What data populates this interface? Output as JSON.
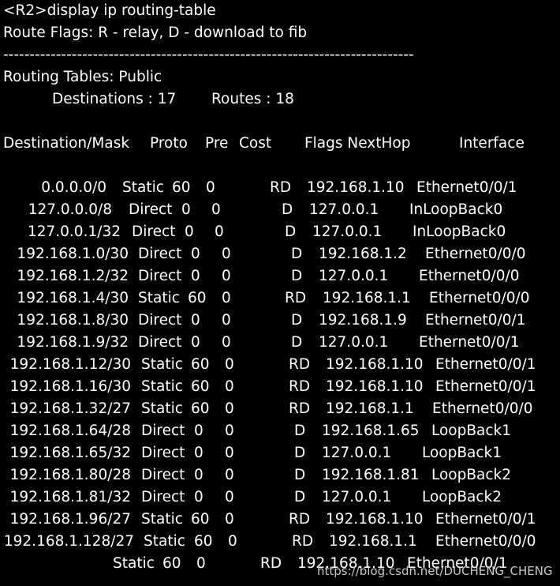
{
  "terminal": {
    "command_line": "<R2>display ip routing-table",
    "route_flags": "Route Flags: R - relay, D - download to fib",
    "separator": "------------------------------------------------------------------------------",
    "table_name": "Routing Tables: Public",
    "destinations_label": "Destinations : 17",
    "routes_label": "Routes : 18",
    "headers": {
      "destination": "Destination/Mask",
      "proto": "Proto",
      "pre": "Pre",
      "cost": "Cost",
      "flags_nexthop": "Flags NextHop",
      "interface": "Interface"
    },
    "rows": [
      {
        "dest": "0.0.0.0/0",
        "proto": "Static",
        "pre": "60",
        "cost": "0",
        "flags": "RD",
        "nexthop": "192.168.1.10",
        "iface": "Ethernet0/0/1"
      },
      {
        "dest": "127.0.0.0/8",
        "proto": "Direct",
        "pre": "0",
        "cost": "0",
        "flags": "D",
        "nexthop": "127.0.0.1",
        "iface": "InLoopBack0"
      },
      {
        "dest": "127.0.0.1/32",
        "proto": "Direct",
        "pre": "0",
        "cost": "0",
        "flags": "D",
        "nexthop": "127.0.0.1",
        "iface": "InLoopBack0"
      },
      {
        "dest": "192.168.1.0/30",
        "proto": "Direct",
        "pre": "0",
        "cost": "0",
        "flags": "D",
        "nexthop": "192.168.1.2",
        "iface": "Ethernet0/0/0"
      },
      {
        "dest": "192.168.1.2/32",
        "proto": "Direct",
        "pre": "0",
        "cost": "0",
        "flags": "D",
        "nexthop": "127.0.0.1",
        "iface": "Ethernet0/0/0"
      },
      {
        "dest": "192.168.1.4/30",
        "proto": "Static",
        "pre": "60",
        "cost": "0",
        "flags": "RD",
        "nexthop": "192.168.1.1",
        "iface": "Ethernet0/0/0"
      },
      {
        "dest": "192.168.1.8/30",
        "proto": "Direct",
        "pre": "0",
        "cost": "0",
        "flags": "D",
        "nexthop": "192.168.1.9",
        "iface": "Ethernet0/0/1"
      },
      {
        "dest": "192.168.1.9/32",
        "proto": "Direct",
        "pre": "0",
        "cost": "0",
        "flags": "D",
        "nexthop": "127.0.0.1",
        "iface": "Ethernet0/0/1"
      },
      {
        "dest": "192.168.1.12/30",
        "proto": "Static",
        "pre": "60",
        "cost": "0",
        "flags": "RD",
        "nexthop": "192.168.1.10",
        "iface": "Ethernet0/0/1"
      },
      {
        "dest": "192.168.1.16/30",
        "proto": "Static",
        "pre": "60",
        "cost": "0",
        "flags": "RD",
        "nexthop": "192.168.1.10",
        "iface": "Ethernet0/0/1"
      },
      {
        "dest": "192.168.1.32/27",
        "proto": "Static",
        "pre": "60",
        "cost": "0",
        "flags": "RD",
        "nexthop": "192.168.1.1",
        "iface": "Ethernet0/0/0"
      },
      {
        "dest": "192.168.1.64/28",
        "proto": "Direct",
        "pre": "0",
        "cost": "0",
        "flags": "D",
        "nexthop": "192.168.1.65",
        "iface": "LoopBack1"
      },
      {
        "dest": "192.168.1.65/32",
        "proto": "Direct",
        "pre": "0",
        "cost": "0",
        "flags": "D",
        "nexthop": "127.0.0.1",
        "iface": "LoopBack1"
      },
      {
        "dest": "192.168.1.80/28",
        "proto": "Direct",
        "pre": "0",
        "cost": "0",
        "flags": "D",
        "nexthop": "192.168.1.81",
        "iface": "LoopBack2"
      },
      {
        "dest": "192.168.1.81/32",
        "proto": "Direct",
        "pre": "0",
        "cost": "0",
        "flags": "D",
        "nexthop": "127.0.0.1",
        "iface": "LoopBack2"
      },
      {
        "dest": "192.168.1.96/27",
        "proto": "Static",
        "pre": "60",
        "cost": "0",
        "flags": "RD",
        "nexthop": "192.168.1.10",
        "iface": "Ethernet0/0/1"
      },
      {
        "dest": "192.168.1.128/27",
        "proto": "Static",
        "pre": "60",
        "cost": "0",
        "flags": "RD",
        "nexthop": "192.168.1.1",
        "iface": "Ethernet0/0/0"
      },
      {
        "dest": "",
        "proto": "Static",
        "pre": "60",
        "cost": "0",
        "flags": "RD",
        "nexthop": "192.168.1.10",
        "iface": "Ethernet0/0/1"
      }
    ],
    "watermark": "https://blog.csdn.net/DUCHENG_CHENG"
  }
}
